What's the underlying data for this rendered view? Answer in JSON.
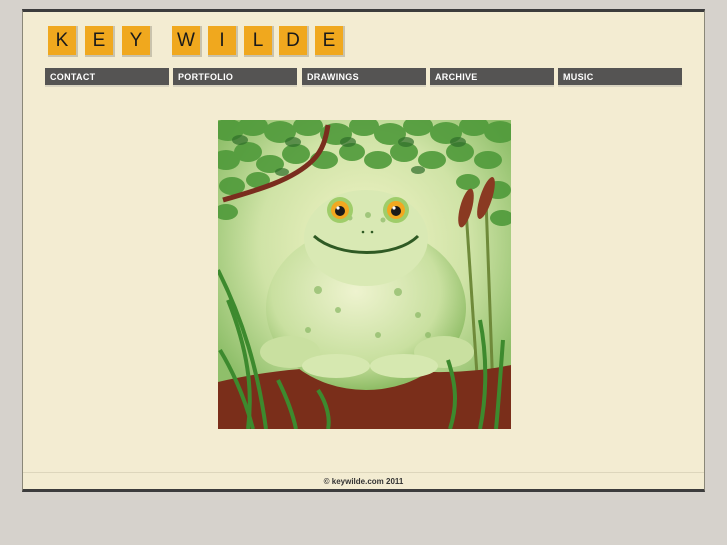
{
  "logo": {
    "letters": [
      "K",
      "E",
      "Y",
      "W",
      "I",
      "L",
      "D",
      "E"
    ],
    "tile_color": "#f0a81e"
  },
  "nav": {
    "items": [
      {
        "label": "CONTACT"
      },
      {
        "label": "PORTFOLIO"
      },
      {
        "label": "DRAWINGS"
      },
      {
        "label": "ARCHIVE"
      },
      {
        "label": "MUSIC"
      }
    ],
    "color": "#555453"
  },
  "artwork": {
    "subject": "frog-illustration-icon"
  },
  "footer": {
    "copyright": "© keywilde.com 2011"
  }
}
